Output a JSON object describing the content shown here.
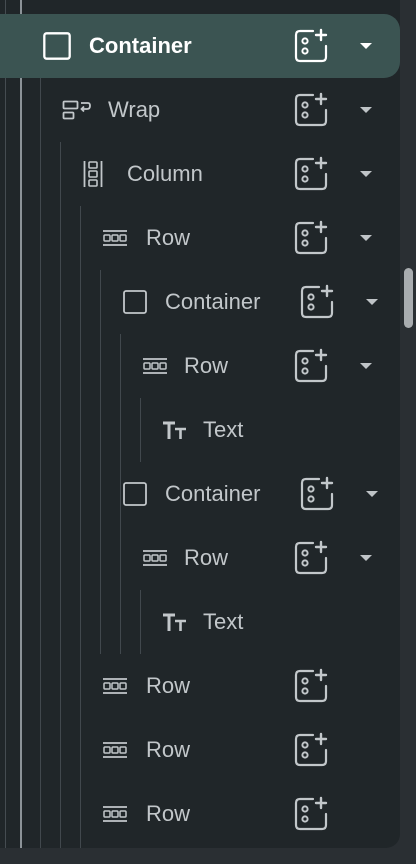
{
  "tree": {
    "nodes": [
      {
        "label": "Container",
        "icon": "container-icon",
        "selected": true,
        "has_chevron": true
      },
      {
        "label": "Wrap",
        "icon": "wrap-icon",
        "selected": false,
        "has_chevron": true
      },
      {
        "label": "Column",
        "icon": "column-icon",
        "selected": false,
        "has_chevron": true
      },
      {
        "label": "Row",
        "icon": "row-icon",
        "selected": false,
        "has_chevron": true
      },
      {
        "label": "Container",
        "icon": "container-icon",
        "selected": false,
        "has_chevron": true
      },
      {
        "label": "Row",
        "icon": "row-icon",
        "selected": false,
        "has_chevron": true
      },
      {
        "label": "Text",
        "icon": "text-icon",
        "selected": false,
        "has_chevron": false
      },
      {
        "label": "Container",
        "icon": "container-icon",
        "selected": false,
        "has_chevron": true
      },
      {
        "label": "Row",
        "icon": "row-icon",
        "selected": false,
        "has_chevron": true
      },
      {
        "label": "Text",
        "icon": "text-icon",
        "selected": false,
        "has_chevron": false
      },
      {
        "label": "Row",
        "icon": "row-icon",
        "selected": false,
        "has_chevron": false
      },
      {
        "label": "Row",
        "icon": "row-icon",
        "selected": false,
        "has_chevron": false
      },
      {
        "label": "Row",
        "icon": "row-icon",
        "selected": false,
        "has_chevron": false
      }
    ]
  },
  "colors": {
    "panel_background": "#202629",
    "selected_row": "#3b5452",
    "label_text": "#c2c7ca",
    "selected_text": "#ffffff",
    "guide_line": "#41484d",
    "scrollbar_thumb": "#a9adb0"
  }
}
